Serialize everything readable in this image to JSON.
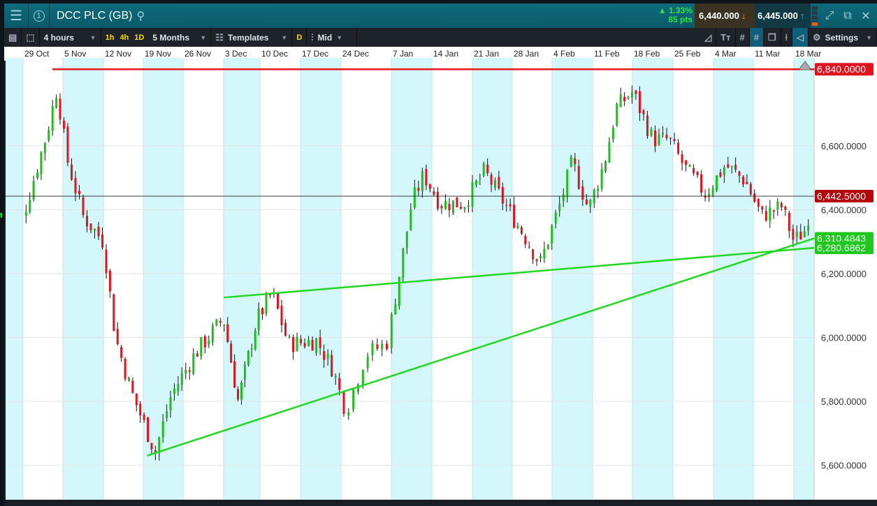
{
  "header": {
    "instrument": "DCC PLC (GB)",
    "change_pct": "▲ 1.33%",
    "change_pts": "85 pts",
    "sell": "6,440.000",
    "buy": "6,445.000",
    "badge": "1"
  },
  "toolbar": {
    "interval": "4 hours",
    "quick": [
      "1h",
      "4h",
      "1D"
    ],
    "range": "5 Months",
    "templates": "Templates",
    "d": "D",
    "price_type": "Mid",
    "settings": "Settings"
  },
  "colors": {
    "up": "#1fbd1f",
    "down": "#e0141e",
    "hline": "#e8141e",
    "trend": "#22d622",
    "band": "#d4f7fb"
  },
  "chart_data": {
    "type": "candlestick",
    "x_labels": [
      "29 Oct",
      "5 Nov",
      "12 Nov",
      "19 Nov",
      "26 Nov",
      "3 Dec",
      "10 Dec",
      "17 Dec",
      "24 Dec",
      "7 Jan",
      "14 Jan",
      "21 Jan",
      "28 Jan",
      "4 Feb",
      "11 Feb",
      "18 Feb",
      "25 Feb",
      "4 Mar",
      "11 Mar",
      "18 Mar"
    ],
    "y_ticks": [
      "6,600.0000",
      "6,400.0000",
      "6,200.0000",
      "6,000.0000",
      "5,800.0000",
      "5,600.0000"
    ],
    "y_tick_values": [
      6600,
      6400,
      6200,
      6000,
      5800,
      5600
    ],
    "ylim": [
      5530,
      6950
    ],
    "path": [
      [
        0,
        6380
      ],
      [
        0.6,
        6640
      ],
      [
        0.85,
        6780
      ],
      [
        1.1,
        6560
      ],
      [
        1.5,
        6380
      ],
      [
        2.0,
        6300
      ],
      [
        2.3,
        6000
      ],
      [
        2.7,
        5830
      ],
      [
        3.3,
        5640
      ],
      [
        3.7,
        5820
      ],
      [
        4.3,
        5950
      ],
      [
        5.0,
        6060
      ],
      [
        5.4,
        5800
      ],
      [
        5.9,
        6050
      ],
      [
        6.3,
        6140
      ],
      [
        6.7,
        5980
      ],
      [
        7.4,
        5990
      ],
      [
        7.8,
        5900
      ],
      [
        8.1,
        5770
      ],
      [
        8.5,
        5950
      ],
      [
        8.9,
        5980
      ],
      [
        9.2,
        6200
      ],
      [
        9.5,
        6420
      ],
      [
        9.8,
        6510
      ],
      [
        10.2,
        6420
      ],
      [
        10.8,
        6420
      ],
      [
        11.3,
        6520
      ],
      [
        11.8,
        6420
      ],
      [
        12.3,
        6320
      ],
      [
        12.7,
        6230
      ],
      [
        13.2,
        6420
      ],
      [
        13.5,
        6550
      ],
      [
        13.9,
        6400
      ],
      [
        14.3,
        6550
      ],
      [
        14.6,
        6720
      ],
      [
        15.0,
        6770
      ],
      [
        15.5,
        6620
      ],
      [
        15.9,
        6620
      ],
      [
        16.3,
        6530
      ],
      [
        16.8,
        6450
      ],
      [
        17.3,
        6540
      ],
      [
        17.8,
        6490
      ],
      [
        18.2,
        6380
      ],
      [
        18.7,
        6410
      ],
      [
        19.0,
        6300
      ],
      [
        19.3,
        6340
      ],
      [
        19.45,
        6442
      ]
    ],
    "current_price": "6,442.5000",
    "hline": {
      "value": 6840,
      "label": "6,840.0000"
    },
    "trendlines": [
      {
        "from": [
          5.0,
          6125
        ],
        "to_label": "6,280.6862",
        "to_value": 6280.6862
      },
      {
        "from": [
          3.1,
          5630
        ],
        "to_label": "6,310.4843",
        "to_value": 6310.4843
      }
    ]
  }
}
